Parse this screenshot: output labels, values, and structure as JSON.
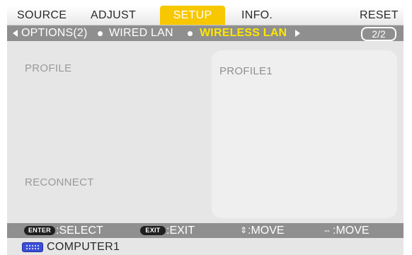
{
  "tabs": {
    "source": "SOURCE",
    "adjust": "ADJUST",
    "setup": "SETUP",
    "info": "INFO.",
    "reset": "RESET"
  },
  "subtabs": {
    "options2": "OPTIONS(2)",
    "wired_lan": "WIRED LAN",
    "wireless_lan": "WIRELESS LAN",
    "page_indicator": "2/2"
  },
  "content": {
    "profile_label": "PROFILE",
    "profile_value": "PROFILE1",
    "reconnect_label": "RECONNECT"
  },
  "help": {
    "enter_key": "ENTER",
    "enter_action": ":SELECT",
    "exit_key": "EXIT",
    "exit_action": ":EXIT",
    "updown_glyph": "⇕",
    "updown_action": ":MOVE",
    "leftright_glyph": "⇔",
    "leftright_action": ":MOVE"
  },
  "status": {
    "source_name": "COMPUTER1",
    "source_icon": "computer-input-icon"
  },
  "colors": {
    "active_tab": "#f7c700",
    "active_subtab_text": "#ffe600",
    "bars": "#8f8f8f",
    "background": "#e6e6e6"
  }
}
